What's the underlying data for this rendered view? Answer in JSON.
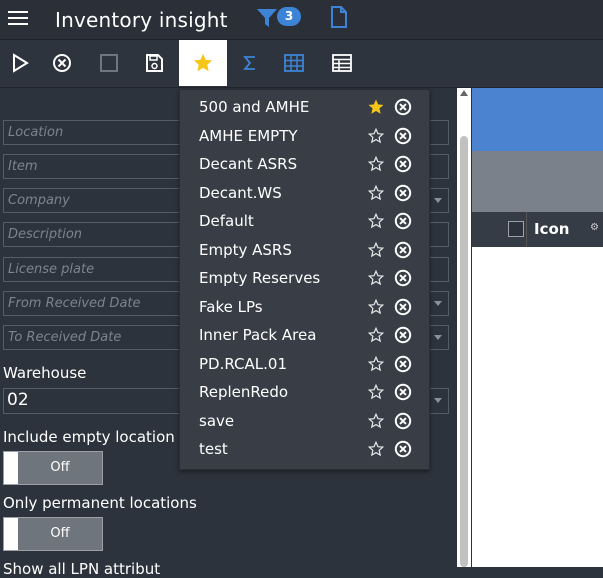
{
  "header": {
    "title": "Inventory insight",
    "filter_count": "3"
  },
  "toolbar": {
    "buttons": [
      "play-icon",
      "cancel-icon",
      "checkbox-icon",
      "save-icon",
      "star-icon",
      "sigma-icon",
      "grid-icon",
      "table-icon"
    ],
    "active": "star-icon"
  },
  "filters": {
    "fields": [
      {
        "placeholder": "Location",
        "has_dropdown": false
      },
      {
        "placeholder": "Item",
        "has_dropdown": false
      },
      {
        "placeholder": "Company",
        "has_dropdown": true
      },
      {
        "placeholder": "Description",
        "has_dropdown": false
      },
      {
        "placeholder": "License plate",
        "has_dropdown": false
      },
      {
        "placeholder": "From Received Date",
        "has_dropdown": true
      },
      {
        "placeholder": "To Received Date",
        "has_dropdown": true
      }
    ],
    "warehouse_label": "Warehouse",
    "warehouse_value": "02",
    "include_empty_label": "Include empty location",
    "include_empty_value": "Off",
    "only_permanent_label": "Only permanent locations",
    "only_permanent_value": "Off",
    "show_lpn_label": "Show all LPN attribut"
  },
  "grid": {
    "icon_column": "Icon"
  },
  "favorites": {
    "items": [
      {
        "name": "500 and AMHE",
        "starred": true
      },
      {
        "name": "AMHE EMPTY",
        "starred": false
      },
      {
        "name": "Decant ASRS",
        "starred": false
      },
      {
        "name": "Decant.WS",
        "starred": false
      },
      {
        "name": "Default",
        "starred": false
      },
      {
        "name": "Empty ASRS",
        "starred": false
      },
      {
        "name": "Empty Reserves",
        "starred": false
      },
      {
        "name": "Fake LPs",
        "starred": false
      },
      {
        "name": "Inner Pack Area",
        "starred": false
      },
      {
        "name": "PD.RCAL.01",
        "starred": false
      },
      {
        "name": "ReplenRedo",
        "starred": false
      },
      {
        "name": "save",
        "starred": false
      },
      {
        "name": "test",
        "starred": false
      }
    ]
  },
  "colors": {
    "accent": "#3d84d6",
    "star_active": "#f5c518",
    "panel_bg": "#2d333c",
    "dropdown_bg": "#393e46"
  }
}
